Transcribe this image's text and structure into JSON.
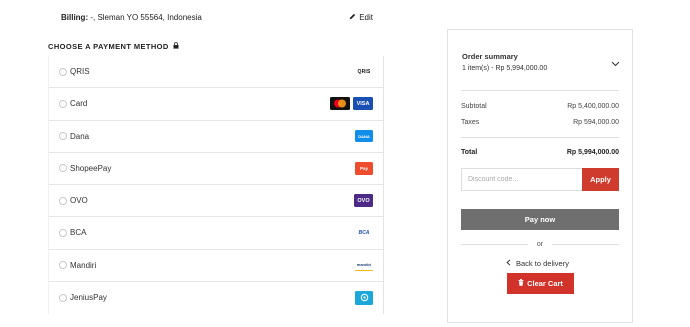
{
  "billing": {
    "label": "Billing:",
    "address": " -, Sleman YO 55564, Indonesia",
    "edit_label": "Edit",
    "edit_icon": "pencil-icon"
  },
  "payment": {
    "title": "CHOOSE A PAYMENT METHOD",
    "title_icon": "lock-icon",
    "methods": [
      {
        "label": "QRIS",
        "logos": [
          "qris-logo"
        ]
      },
      {
        "label": "Card",
        "logos": [
          "mastercard-logo",
          "visa-logo"
        ]
      },
      {
        "label": "Dana",
        "logos": [
          "dana-logo"
        ]
      },
      {
        "label": "ShopeePay",
        "logos": [
          "shopeepay-logo"
        ]
      },
      {
        "label": "OVO",
        "logos": [
          "ovo-logo"
        ]
      },
      {
        "label": "BCA",
        "logos": [
          "bca-logo"
        ]
      },
      {
        "label": "Mandiri",
        "logos": [
          "mandiri-logo"
        ]
      },
      {
        "label": "JeniusPay",
        "logos": [
          "jenius-logo"
        ]
      }
    ],
    "logo_text": {
      "qris": "QRIS",
      "visa": "VISA",
      "dana": "DANA",
      "shopeepay": "Pay",
      "ovo": "OVO",
      "bca": "BCA",
      "mandiri": "mandiri"
    }
  },
  "summary": {
    "title": "Order summary",
    "items_text": "1 item(s) -  Rp 5,994,000.00",
    "subtotal_label": "Subtotal",
    "subtotal_value": "Rp 5,400,000.00",
    "taxes_label": "Taxes",
    "taxes_value": "Rp 594,000.00",
    "total_label": "Total",
    "total_value": "Rp 5,994,000.00",
    "discount_placeholder": "Discount code...",
    "apply_label": "Apply",
    "pay_label": "Pay now",
    "or_label": "or",
    "back_label": "Back to delivery",
    "clear_label": "Clear Cart"
  },
  "colors": {
    "accent_red": "#cf3b2c",
    "pay_gray": "#6f6f6f",
    "visa_blue": "#1a4fb3",
    "ovo_purple": "#4c2a86",
    "shopee_orange": "#ee4d2d",
    "dana_blue": "#118eea",
    "jenius_cyan": "#1ba7d9"
  }
}
